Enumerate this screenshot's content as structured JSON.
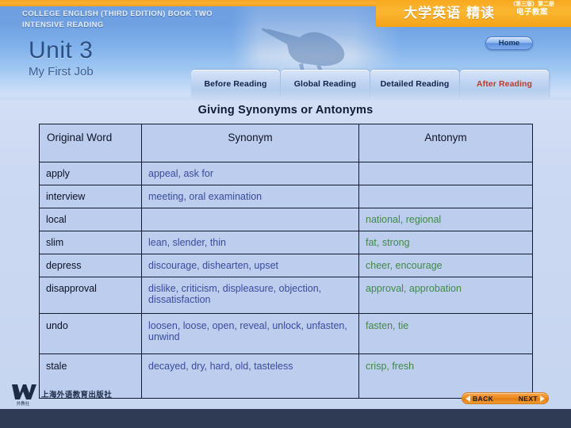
{
  "header": {
    "book_line_1": "COLLEGE ENGLISH (THIRD EDITION) BOOK TWO",
    "book_line_2": "INTENSIVE READING",
    "unit_title": "Unit 3",
    "unit_subtitle": "My First Job",
    "cn_title": "大学英语 精读",
    "cn_edition": "（第三版）第二册",
    "cn_courseware": "电子教案",
    "home_label": "Home"
  },
  "tabs": [
    {
      "label": "Before Reading",
      "active": false
    },
    {
      "label": "Global Reading",
      "active": false
    },
    {
      "label": "Detailed Reading",
      "active": false
    },
    {
      "label": "After Reading",
      "active": true
    }
  ],
  "main": {
    "title": "Giving Synonyms or Antonyms",
    "columns": [
      "Original Word",
      "Synonym",
      "Antonym"
    ],
    "rows": [
      {
        "word": "apply",
        "synonym": "appeal, ask for",
        "antonym": ""
      },
      {
        "word": "interview",
        "synonym": "meeting, oral examination",
        "antonym": ""
      },
      {
        "word": "local",
        "synonym": "",
        "antonym": "national, regional"
      },
      {
        "word": "slim",
        "synonym": "lean, slender, thin",
        "antonym": "fat, strong"
      },
      {
        "word": "depress",
        "synonym": "discourage, dishearten, upset",
        "antonym": "cheer, encourage"
      },
      {
        "word": "disapproval",
        "synonym": "dislike, criticism, displeasure, objection, dissatisfaction",
        "antonym": "approval, approbation"
      },
      {
        "word": "undo",
        "synonym": "loosen, loose, open, reveal, unlock, unfasten, unwind",
        "antonym": "fasten, tie"
      },
      {
        "word": "stale",
        "synonym": "decayed, dry, hard, old, tasteless",
        "antonym": "crisp, fresh"
      }
    ]
  },
  "footer": {
    "publisher": "上海外语教育出版社",
    "logo_text": "外教社",
    "back_label": "BACK",
    "next_label": "NEXT"
  },
  "colors": {
    "accent_orange": "#f7a81f",
    "tab_active_text": "#c0392b",
    "synonym_text": "#3a4b9b",
    "antonym_text": "#3f8a46",
    "table_bg": "#bdcdee",
    "footer_bar": "#2f3b55"
  }
}
